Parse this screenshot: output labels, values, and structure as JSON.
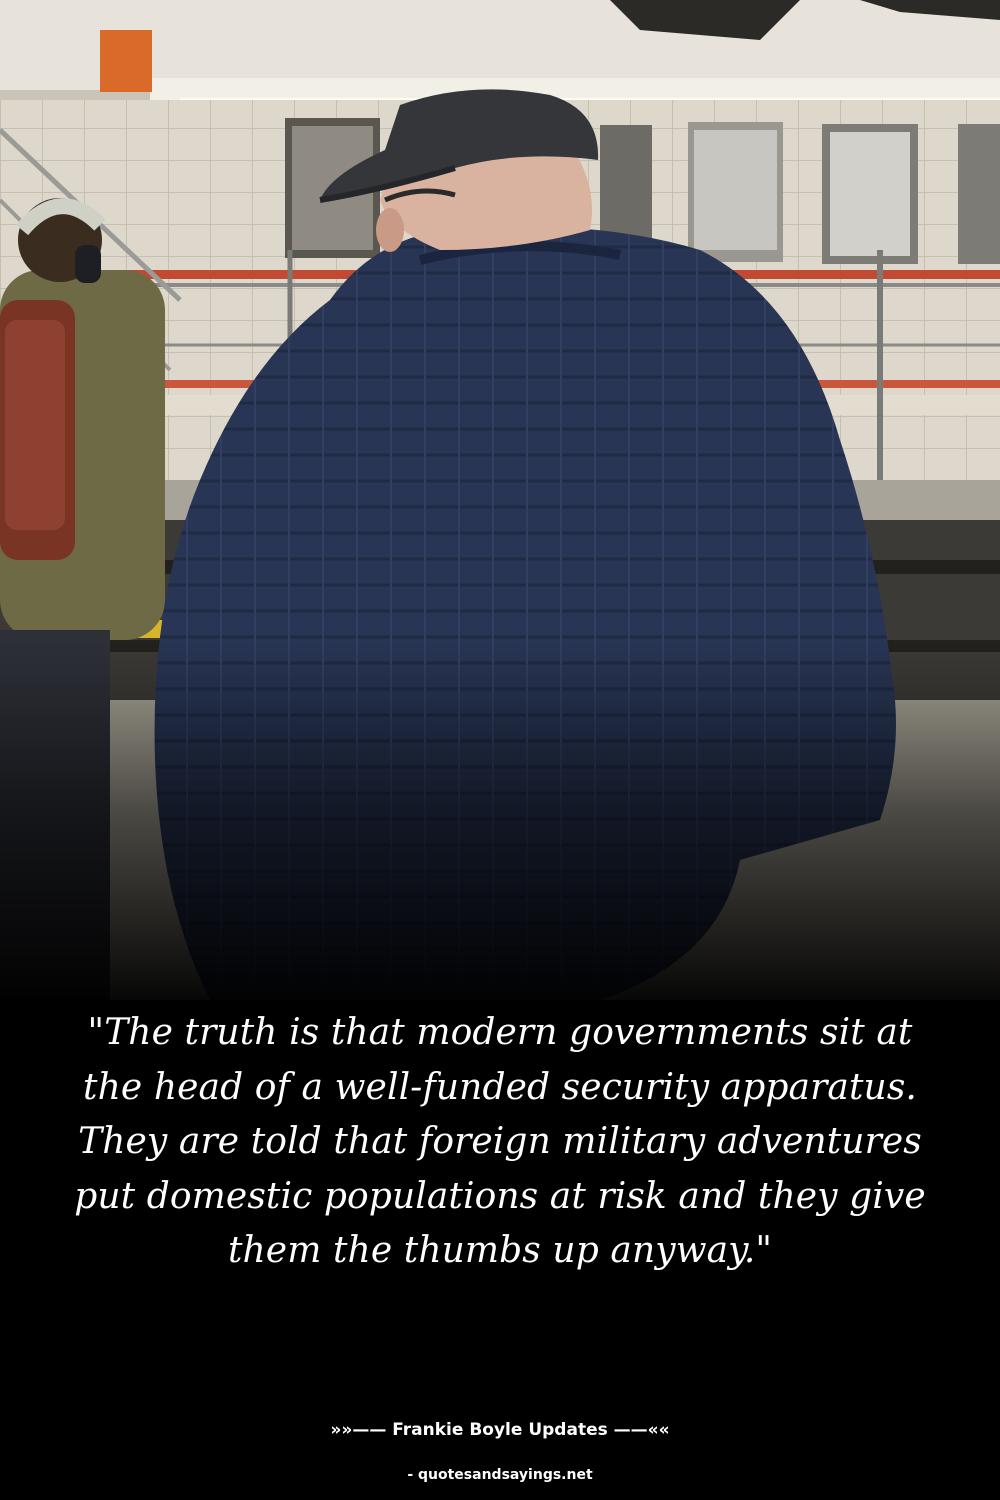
{
  "quote": {
    "text": "\"The truth is that modern governments sit at the head of a well-funded security apparatus. They are told that foreign military adventures put domestic populations at risk and they give them the thumbs up anyway.\""
  },
  "attribution": {
    "text": "»»—— Frankie Boyle Updates ——««"
  },
  "source": {
    "text": "- quotesandsayings.net"
  },
  "colors": {
    "text": "#ffffff",
    "background": "#000000",
    "sweater": "#2a3654"
  }
}
